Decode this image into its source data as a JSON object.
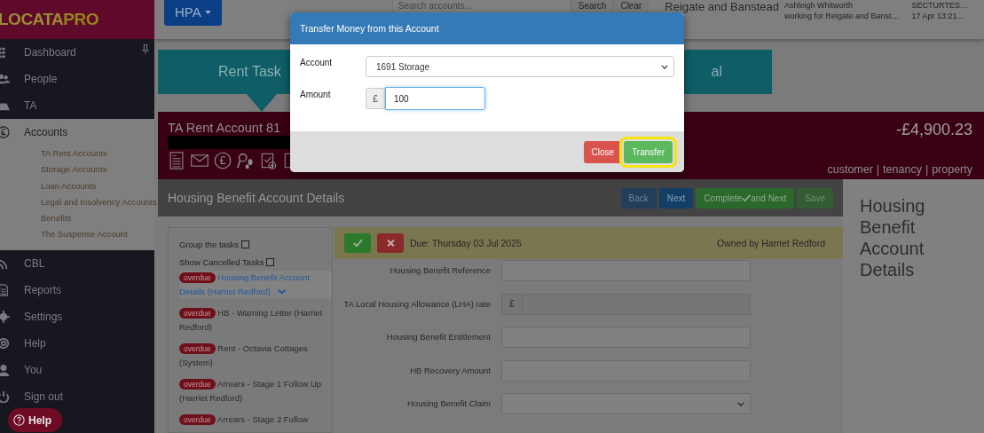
{
  "logo": {
    "part1": "LOCATA",
    "part2": "PRO"
  },
  "top_bar": {
    "org_button": "HPA",
    "search": {
      "placeholder": "Search accounts..."
    },
    "search_button": "Search",
    "clear_button": "Clear",
    "organisation": "Reigate and Banstead",
    "user": [
      "Ashleigh Whitworth",
      "working for Reigate and Banst…"
    ],
    "session": [
      "SECTURTES…",
      "17 Apr 13:21…"
    ]
  },
  "sidebar": {
    "items": [
      {
        "label": "Dashboard",
        "selected": false
      },
      {
        "label": "People",
        "selected": false
      },
      {
        "label": "TA",
        "selected": false
      },
      {
        "label": "Accounts",
        "selected": true,
        "children": [
          {
            "label": "TA Rent Accounts"
          },
          {
            "label": "Storage Accounts"
          },
          {
            "label": "Loan Accounts"
          },
          {
            "label": "Legal and Insolvency Accounts"
          },
          {
            "label": "Benefits"
          },
          {
            "label": "The Suspense Account"
          }
        ]
      },
      {
        "label": "CBL",
        "selected": false
      },
      {
        "label": "Reports",
        "selected": false
      },
      {
        "label": "Settings",
        "selected": false
      },
      {
        "label": "Help",
        "selected": false
      },
      {
        "label": "You",
        "selected": false
      },
      {
        "label": "Sign out",
        "selected": false
      }
    ]
  },
  "banner": {
    "left": "Rent Task",
    "right": "al"
  },
  "account": {
    "title": "TA Rent Account 81",
    "balance": "-£4,900.23",
    "links": [
      "customer",
      "tenancy",
      "property"
    ],
    "link_separator": "|"
  },
  "section": {
    "title": "Housing Benefit Account Details",
    "buttons": [
      {
        "label": "Back",
        "kind": "primary",
        "disabled": true
      },
      {
        "label": "Next",
        "kind": "primary",
        "disabled": false
      },
      {
        "label": "Complete",
        "label_after": "and Next",
        "kind": "success",
        "disabled": false
      },
      {
        "label": "Save",
        "kind": "success",
        "disabled": true
      }
    ]
  },
  "side_heading": "Housing Benefit Account Details",
  "task_options": [
    {
      "label": "Group the tasks",
      "checked": false
    },
    {
      "label": "Show Cancelled Tasks",
      "checked": false
    }
  ],
  "tasks": [
    {
      "badge": "overdue",
      "title": "Housing Benefit Account Details (Harriet Redford)",
      "selected": true
    },
    {
      "badge": "overdue",
      "title": "HB - Warning Letter (Harriet Redford)",
      "selected": false
    },
    {
      "badge": "overdue",
      "title": "Rent - Octavia Cottages (System)",
      "selected": false
    },
    {
      "badge": "overdue",
      "title": "Arrears - Stage 1 Follow Up (Harriet Redford)",
      "selected": false
    },
    {
      "badge": "overdue",
      "title": "Arrears - Stage 2 Follow",
      "selected": false
    }
  ],
  "due_bar": {
    "due": "Due: Thursday 03 Jul 2025",
    "owner": "Owned by Harriet Redford"
  },
  "form": [
    {
      "label": "Housing Benefit Reference",
      "kind": "text"
    },
    {
      "label": "TA Local Housing Allowance (LHA) rate",
      "kind": "currency",
      "prefix": "£"
    },
    {
      "label": "Housing Benefit Entitlement",
      "kind": "text"
    },
    {
      "label": "HB Recovery Amount",
      "kind": "text"
    },
    {
      "label": "Housing Benefit Claim",
      "kind": "select"
    }
  ],
  "modal": {
    "title": "Transfer Money from this Account",
    "account_label": "Account",
    "account_value": "1691 Storage",
    "amount_label": "Amount",
    "amount_prefix": "£",
    "amount_value": "100",
    "buttons": [
      {
        "label": "Close",
        "kind": "danger",
        "highlighted": false
      },
      {
        "label": "Transfer",
        "kind": "success",
        "highlighted": true
      }
    ]
  },
  "help_button": "Help"
}
